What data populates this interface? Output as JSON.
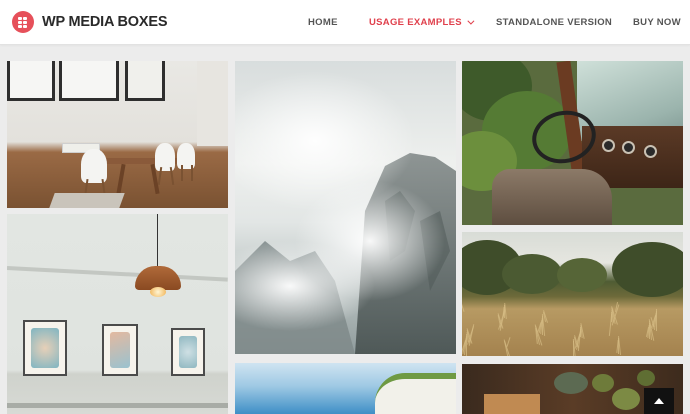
{
  "header": {
    "logo_text": "WP MEDIA BOXES",
    "logo_color": "#e6505a",
    "nav": [
      {
        "label": "HOME",
        "active": false
      },
      {
        "label": "USAGE EXAMPLES",
        "active": true,
        "has_dropdown": true
      },
      {
        "label": "STANDALONE VERSION",
        "active": false
      },
      {
        "label": "BUY NOW",
        "active": false
      }
    ],
    "active_color": "#e0404c"
  },
  "gallery": {
    "items": [
      {
        "subject": "dining room with white chairs"
      },
      {
        "subject": "foggy mountain rock"
      },
      {
        "subject": "old car interior"
      },
      {
        "subject": "pendant lamp and framed art"
      },
      {
        "subject": "wheat field"
      },
      {
        "subject": "coastal cliff"
      },
      {
        "subject": "herbs and mortar"
      }
    ]
  },
  "scroll_top": {
    "icon": "arrow-up-icon"
  }
}
